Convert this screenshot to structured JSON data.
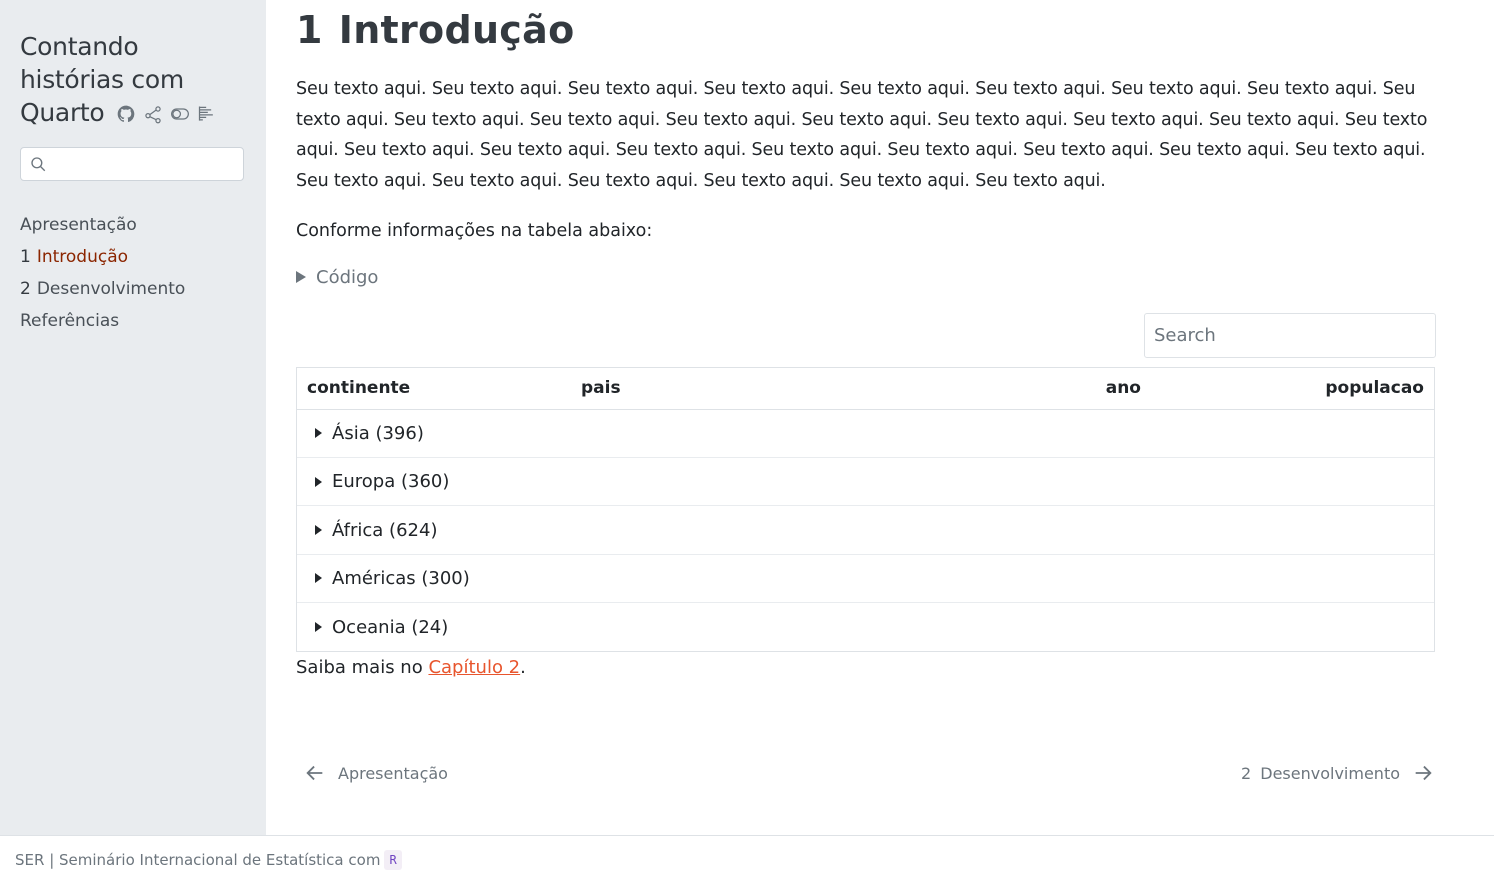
{
  "sidebar": {
    "title_lines": [
      "Contando",
      "histórias com",
      "Quarto"
    ],
    "search_placeholder": "",
    "toc": [
      {
        "num": "",
        "label": "Apresentação",
        "active": false
      },
      {
        "num": "1",
        "label": "Introdução",
        "active": true
      },
      {
        "num": "2",
        "label": "Desenvolvimento",
        "active": false
      },
      {
        "num": "",
        "label": "Referências",
        "active": false
      }
    ]
  },
  "main": {
    "heading_num": "1",
    "heading_text": "Introdução",
    "paragraph": "Seu texto aqui. Seu texto aqui. Seu texto aqui. Seu texto aqui. Seu texto aqui. Seu texto aqui. Seu texto aqui. Seu texto aqui. Seu texto aqui. Seu texto aqui. Seu texto aqui. Seu texto aqui. Seu texto aqui. Seu texto aqui. Seu texto aqui. Seu texto aqui. Seu texto aqui. Seu texto aqui. Seu texto aqui. Seu texto aqui. Seu texto aqui. Seu texto aqui. Seu texto aqui. Seu texto aqui. Seu texto aqui. Seu texto aqui. Seu texto aqui. Seu texto aqui. Seu texto aqui. Seu texto aqui. Seu texto aqui.",
    "paragraph2": "Conforme informações na tabela abaixo:",
    "code_fold_label": "Código",
    "table": {
      "search_placeholder": "Search",
      "columns": [
        "continente",
        "pais",
        "ano",
        "populacao"
      ],
      "groups": [
        "Ásia (396)",
        "Europa (360)",
        "África (624)",
        "Américas (300)",
        "Oceania (24)"
      ]
    },
    "saiba_prefix": "Saiba mais no ",
    "saiba_link": "Capítulo 2",
    "saiba_suffix": "."
  },
  "nav": {
    "prev_label": "Apresentação",
    "next_num": "2",
    "next_label": "Desenvolvimento"
  },
  "footer": {
    "text": "SER | Seminário Internacional de Estatística com",
    "badge": "R"
  },
  "colors": {
    "sidebar_bg": "#e9ecef",
    "active_toc": "#8b2500",
    "link": "#e8552d"
  }
}
